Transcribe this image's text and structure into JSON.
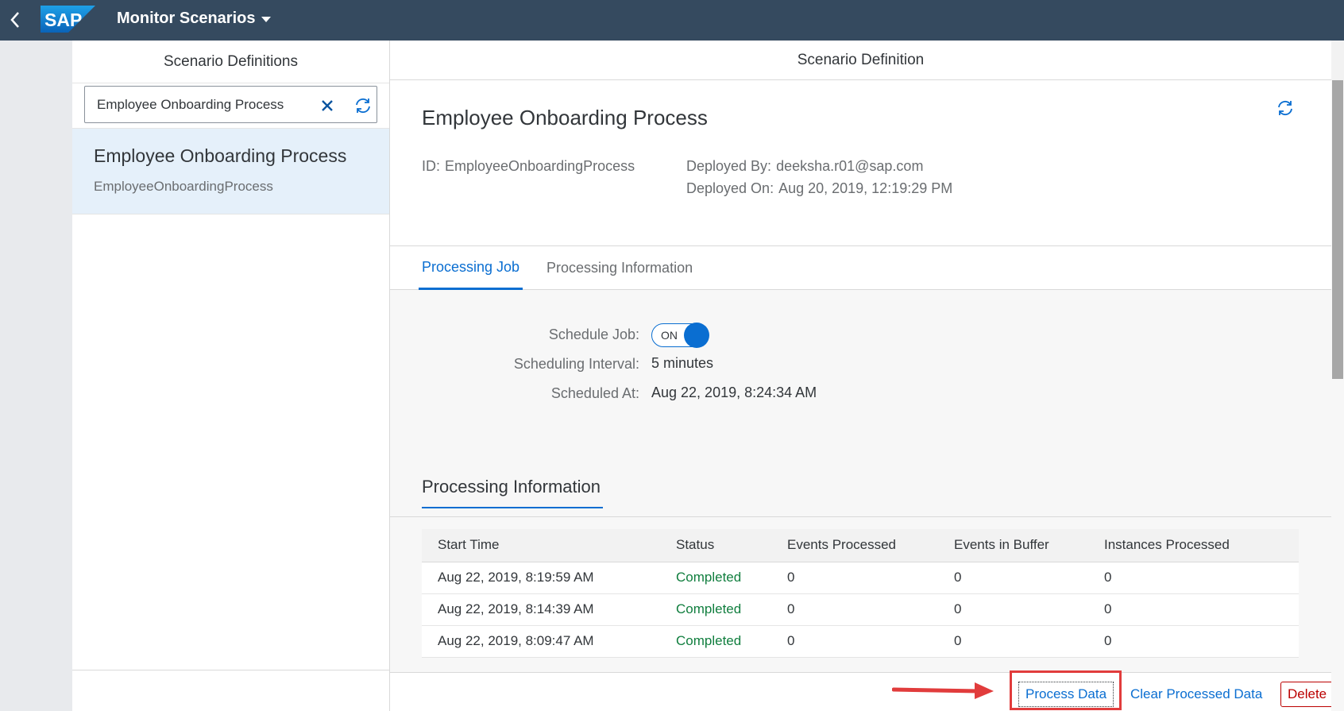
{
  "shell": {
    "title": "Monitor Scenarios",
    "logo_text": "SAP"
  },
  "master": {
    "header": "Scenario Definitions",
    "search_value": "Employee Onboarding Process",
    "items": [
      {
        "title": "Employee Onboarding Process",
        "description": "EmployeeOnboardingProcess"
      }
    ]
  },
  "detail": {
    "header": "Scenario Definition",
    "object_title": "Employee Onboarding Process",
    "id_label": "ID:",
    "id_value": "EmployeeOnboardingProcess",
    "deployed_by_label": "Deployed By:",
    "deployed_by_value": "deeksha.r01@sap.com",
    "deployed_on_label": "Deployed On:",
    "deployed_on_value": "Aug 20, 2019, 12:19:29 PM",
    "tabs": [
      {
        "label": "Processing Job",
        "active": true
      },
      {
        "label": "Processing Information",
        "active": false
      }
    ],
    "job": {
      "schedule_label": "Schedule Job:",
      "schedule_state": "ON",
      "interval_label": "Scheduling Interval:",
      "interval_value": "5 minutes",
      "scheduled_at_label": "Scheduled At:",
      "scheduled_at_value": "Aug 22, 2019, 8:24:34 AM"
    },
    "processing_info": {
      "title": "Processing Information",
      "columns": [
        "Start Time",
        "Status",
        "Events Processed",
        "Events in Buffer",
        "Instances Processed"
      ],
      "rows": [
        [
          "Aug 22, 2019, 8:19:59 AM",
          "Completed",
          "0",
          "0",
          "0"
        ],
        [
          "Aug 22, 2019, 8:14:39 AM",
          "Completed",
          "0",
          "0",
          "0"
        ],
        [
          "Aug 22, 2019, 8:09:47 AM",
          "Completed",
          "0",
          "0",
          "0"
        ]
      ]
    },
    "footer": {
      "process_data": "Process Data",
      "clear_processed_data": "Clear Processed Data",
      "delete": "Delete"
    }
  },
  "colors": {
    "shell": "#354a5f",
    "accent": "#0a6ed1",
    "success": "#107e3e",
    "reject": "#bb0000",
    "annotation": "#e13c3c"
  }
}
